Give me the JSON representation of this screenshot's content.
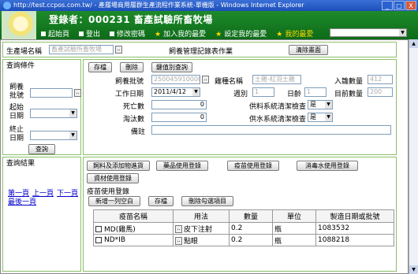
{
  "window": {
    "title": "http://test.ccpos.com.tw/ - 產履場商用履群生產流程作業系統-單機版 - Windows Internet Explorer",
    "buttons": [
      "_",
      "□",
      "X"
    ]
  },
  "header": {
    "login_text": "登錄者：000231 畜產試驗所畜牧場",
    "menu": [
      {
        "label": "起始頁",
        "type": "square"
      },
      {
        "label": "登出",
        "type": "square"
      },
      {
        "label": "修改密碼",
        "type": "square"
      },
      {
        "label": "加入我的最愛",
        "type": "star"
      },
      {
        "label": "設定我的最愛",
        "type": "star"
      },
      {
        "label": "我的最愛",
        "type": "star"
      }
    ],
    "fav_select": ""
  },
  "top_bar": {
    "farm_label": "生產場名稱",
    "farm_value": "畜產試驗所畜牧場",
    "section_title": "飼養管理記錄表作業",
    "clear_button": "清除畫面"
  },
  "query": {
    "title": "查詢條件",
    "batch_label": "飼養批號",
    "start_label": "起始日期",
    "end_label": "終止日期",
    "query_button": "查詢"
  },
  "form": {
    "buttons": {
      "save": "存檔",
      "delete": "刪除",
      "query_by_key": "鍵值別查詢"
    },
    "batch_label": "飼養批號",
    "batch_value": "250045910000",
    "breed_label": "雞種名稱",
    "breed_value": "土雞-紅羽土雞",
    "entry_qty_label": "入雛數量",
    "entry_qty_value": "412",
    "work_date_label": "工作日期",
    "work_date_value": "2011/4/12",
    "week_label": "週別",
    "week_value": "1",
    "day_label": "日齡",
    "day_value": "1",
    "current_qty_label": "目前數量",
    "current_qty_value": "200",
    "dead_label": "死亡數",
    "dead_value": "0",
    "feed_check_label": "供料系統清潔檢查",
    "feed_check_value": "是",
    "cull_label": "淘汰數",
    "cull_value": "0",
    "water_check_label": "供水系統清潔檢查",
    "water_check_value": "是",
    "note_label": "備註",
    "note_value": ""
  },
  "results": {
    "title": "查詢結果",
    "nav": {
      "first": "第一頁",
      "prev": "上一頁",
      "next": "下一頁",
      "last": "最後一頁"
    }
  },
  "tabs": [
    "飼料及添加物進貨",
    "藥品使用登錄",
    "疫苗使用登錄",
    "消毒水使用登錄",
    "資材使用登錄"
  ],
  "vaccine": {
    "title": "疫苗使用登錄",
    "buttons": {
      "add_row": "新增一列空白",
      "save": "存檔",
      "delete_checked": "刪除勾選項目"
    },
    "columns": [
      "疫苗名稱",
      "用法",
      "數量",
      "單位",
      "製造日期或批號"
    ],
    "rows": [
      {
        "name": "MD(雞馬)",
        "usage": "皮下注射",
        "qty": "0.2",
        "unit": "瓶",
        "batch": "1083532"
      },
      {
        "name": "ND*IB",
        "usage": "點眼",
        "qty": "0.2",
        "unit": "瓶",
        "batch": "1088218"
      }
    ]
  }
}
